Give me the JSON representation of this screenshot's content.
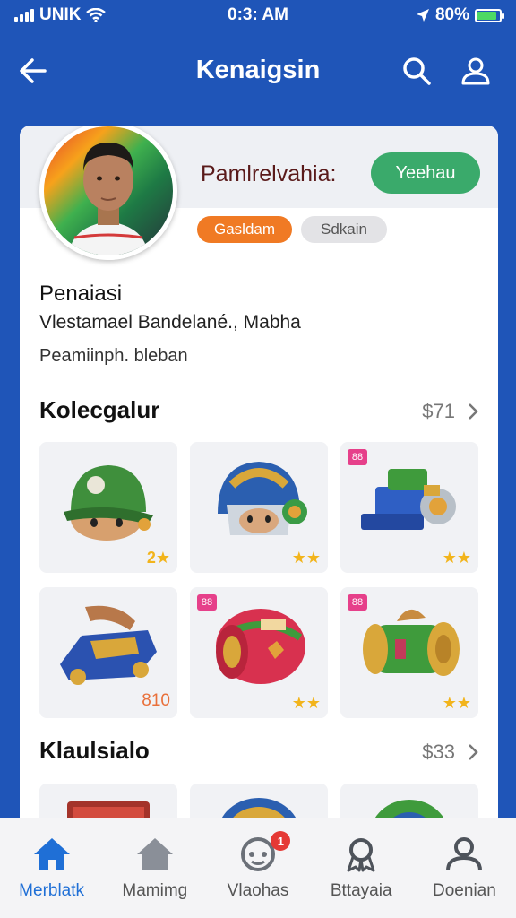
{
  "status_bar": {
    "carrier": "UNIK",
    "time": "0:3: AM",
    "battery": "80%",
    "battery_level": 0.8
  },
  "header": {
    "title": "Kenaigsin",
    "icons": [
      "back-arrow-icon",
      "search-icon",
      "profile-icon"
    ]
  },
  "profile": {
    "display_name": "Pamlrelvahia:",
    "follow_label": "Yeehau",
    "badges": [
      "Gasldam",
      "Sdkain"
    ],
    "name": "Penaiasi",
    "subtitle": "Vlestamael Bandelané., Mabha",
    "meta": "Peamiinph. bleban"
  },
  "collection": {
    "title": "Kolecgalur",
    "count": "$71",
    "items": [
      {
        "name": "green-helmet",
        "rating": "2★"
      },
      {
        "name": "blue-helmet",
        "rating": "★★"
      },
      {
        "name": "blue-cannon",
        "tag": "88",
        "rating": "★★"
      },
      {
        "name": "blue-cart",
        "price": "810"
      },
      {
        "name": "red-drum",
        "tag": "88",
        "rating": "★★"
      },
      {
        "name": "green-drum",
        "tag": "88",
        "rating": "★★"
      }
    ]
  },
  "second_section": {
    "title": "Klaulsialo",
    "count": "$33"
  },
  "bottom_nav": [
    {
      "label": "Merblatk",
      "icon": "home-icon",
      "active": true
    },
    {
      "label": "Mamimg",
      "icon": "house-icon",
      "active": false
    },
    {
      "label": "Vlaohas",
      "icon": "game-icon",
      "active": false,
      "badge": "1"
    },
    {
      "label": "Bttayaia",
      "icon": "ribbon-icon",
      "active": false
    },
    {
      "label": "Doenian",
      "icon": "person-icon",
      "active": false
    }
  ],
  "colors": {
    "header_bg": "#1f55b8",
    "accent": "#1f6fd6",
    "follow_green": "#3aaa6b",
    "badge_orange": "#f07a24",
    "star": "#f2b41b"
  }
}
